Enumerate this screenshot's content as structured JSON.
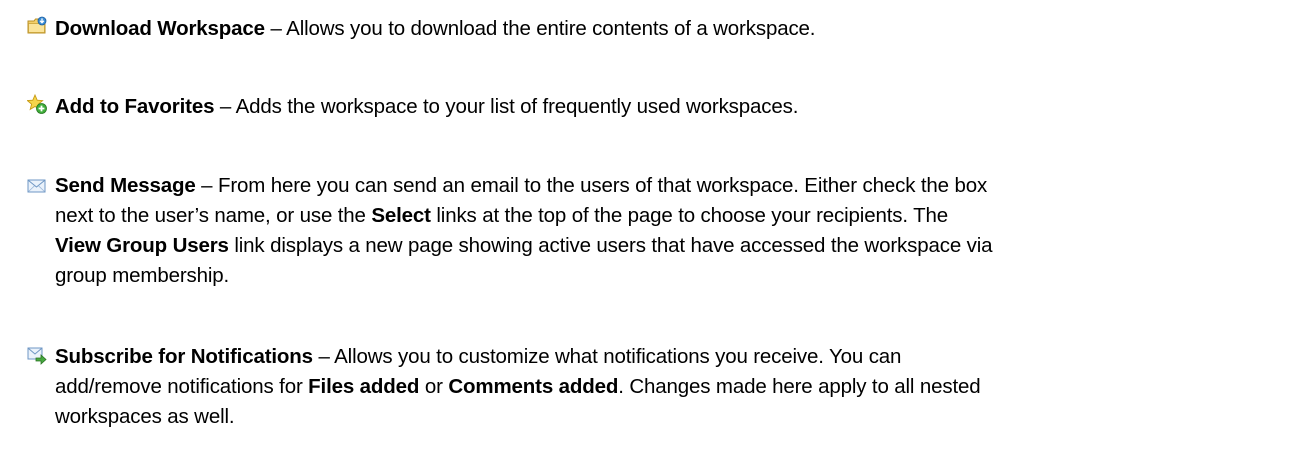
{
  "entries": [
    {
      "icon": "download-workspace-icon",
      "title": "Download Workspace",
      "dash": " – ",
      "line1_rest": "Allows you to download the entire contents of a workspace."
    },
    {
      "icon": "add-favorite-star-icon",
      "title": "Add to Favorites",
      "dash": " – ",
      "line1_rest": "Adds the workspace to your list of frequently used workspaces."
    },
    {
      "icon": "envelope-icon",
      "title": "Send Message",
      "dash": " – ",
      "line1_rest": "From here you can send an email to the users of that workspace. Either check the box",
      "line2_a": "next to the user’s name, or use the ",
      "line2_bold": "Select",
      "line2_b": " links at the top of the page to choose your recipients. The",
      "line3_bold": "View Group Users",
      "line3_rest": " link displays a new page showing active users that have accessed the workspace via",
      "line4": "group membership."
    },
    {
      "icon": "subscribe-notifications-icon",
      "title": "Subscribe for Notifications",
      "dash": " – ",
      "line1_rest": "Allows you to customize what notifications you receive. You can",
      "line2_a": "add/remove notifications for ",
      "line2_bold1": "Files added",
      "line2_mid": " or ",
      "line2_bold2": "Comments added",
      "line2_b": ". Changes made here apply to all nested",
      "line3": "workspaces as well."
    }
  ]
}
